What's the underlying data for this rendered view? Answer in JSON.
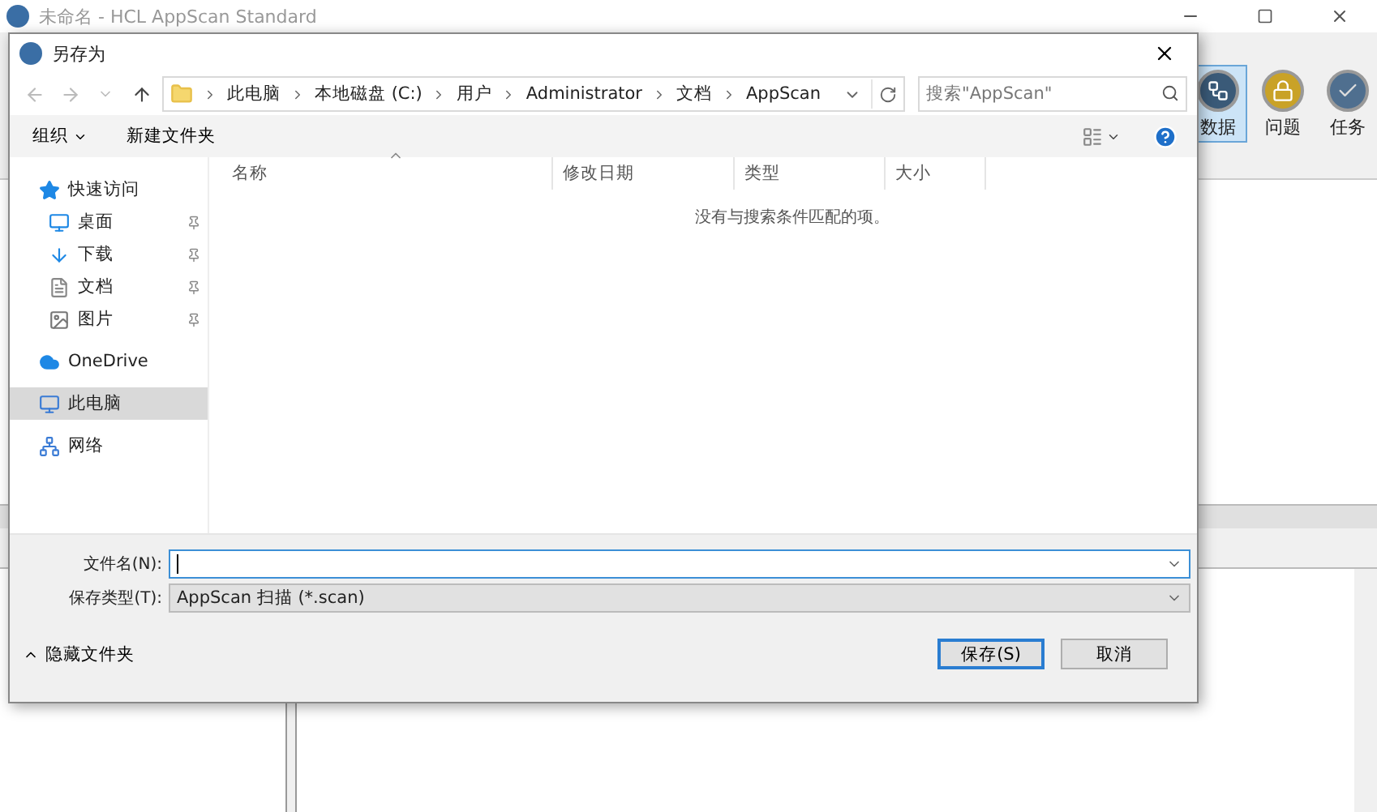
{
  "app": {
    "title": "未命名 - HCL AppScan Standard",
    "ribbon": [
      {
        "label": "数据",
        "selected": true
      },
      {
        "label": "问题",
        "selected": false
      },
      {
        "label": "任务",
        "selected": false
      }
    ]
  },
  "dialog": {
    "title": "另存为",
    "breadcrumb": [
      "此电脑",
      "本地磁盘 (C:)",
      "用户",
      "Administrator",
      "文档",
      "AppScan"
    ],
    "search": {
      "placeholder": "搜索\"AppScan\""
    },
    "toolbar": {
      "organize": "组织",
      "new_folder": "新建文件夹"
    },
    "nav": [
      {
        "label": "快速访问",
        "selected": false,
        "children": [
          {
            "label": "桌面",
            "pinned": true,
            "selected": false
          },
          {
            "label": "下载",
            "pinned": true,
            "selected": false
          },
          {
            "label": "文档",
            "pinned": true,
            "selected": false
          },
          {
            "label": "图片",
            "pinned": true,
            "selected": false
          }
        ]
      },
      {
        "label": "OneDrive",
        "selected": false
      },
      {
        "label": "此电脑",
        "selected": true
      },
      {
        "label": "网络",
        "selected": false
      }
    ],
    "columns": [
      {
        "label": "名称",
        "sorted": true
      },
      {
        "label": "修改日期",
        "sorted": false
      },
      {
        "label": "类型",
        "sorted": false
      },
      {
        "label": "大小",
        "sorted": false
      }
    ],
    "empty_message": "没有与搜索条件匹配的项。",
    "file_name": {
      "label": "文件名(N):"
    },
    "save_type": {
      "label": "保存类型(T):",
      "value": "AppScan 扫描 (*.scan)"
    },
    "hide_folders": "隐藏文件夹",
    "buttons": [
      {
        "label": "保存(S)",
        "default": true
      },
      {
        "label": "取消",
        "default": false
      }
    ]
  }
}
